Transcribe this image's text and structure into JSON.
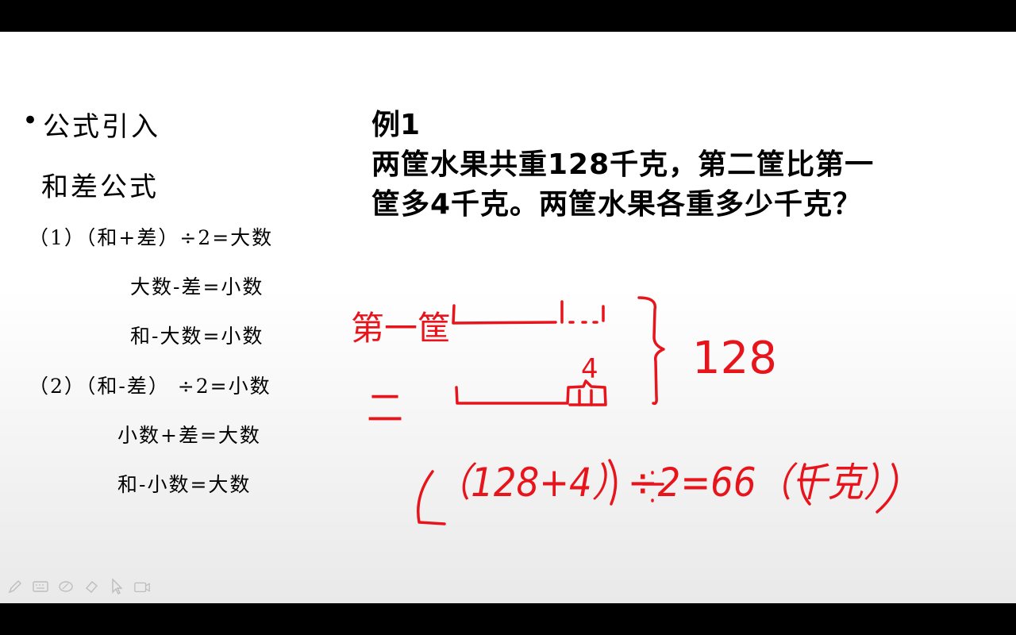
{
  "slide": {
    "bullet": "公式引入",
    "subtitle": "和差公式",
    "formulas": {
      "f1": "（1）（和+差）÷2=大数",
      "f1a": "大数-差=小数",
      "f1b": "和-大数=小数",
      "f2": "（2）（和-差）  ÷2=小数",
      "f2a": "小数+差=大数",
      "f2b": "和-小数=大数"
    },
    "example": {
      "title": "例1",
      "line1": "两筐水果共重128千克，第二筐比第一",
      "line2": "筐多4千克。两筐水果各重多少千克？"
    }
  },
  "annotation": {
    "color": "#e8141c",
    "label_first": "第一筐",
    "label_second": "二",
    "diff": "4",
    "total": "128",
    "equation": "（128+4）÷2=66（千克）"
  },
  "toolbar": {
    "icons": [
      "pen-icon",
      "keyboard-icon",
      "highlighter-icon",
      "eraser-icon",
      "pointer-icon",
      "camera-icon"
    ]
  }
}
